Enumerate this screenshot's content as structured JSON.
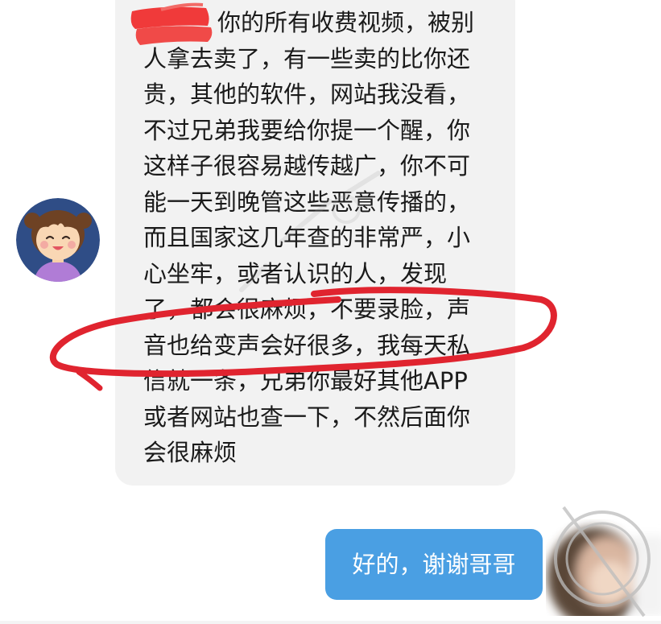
{
  "incoming_message": {
    "lines": [
      "你的所有收费视频，被别",
      "人拿去卖了，有一些卖的比你还",
      "贵，其他的软件，网站我没看，",
      "不过兄弟我要给你提一个醒，你",
      "这样子很容易越传越广，你不可",
      "能一天到晚管这些恶意传播的，",
      "而且国家这几年查的非常严，小",
      "心坐牢，或者认识的人，发现",
      "了，都会很麻烦，不要录脸，声",
      "音也给变声会好很多，我每天私",
      "信就一条，兄弟你最好其他APP",
      "或者网站也查一下，不然后面你",
      "会很麻烦"
    ]
  },
  "outgoing_message": {
    "text": "好的，谢谢哥哥"
  },
  "colors": {
    "incoming_bubble": "#f2f2f2",
    "outgoing_bubble": "#4a9fe3",
    "annotation_red": "#e0242f",
    "redaction_red": "#f03a3a"
  },
  "icons": {
    "left_avatar": "cartoon-girl-avatar",
    "right_avatar": "blurred-profile-avatar",
    "watermark": "circle-slash-watermark"
  }
}
